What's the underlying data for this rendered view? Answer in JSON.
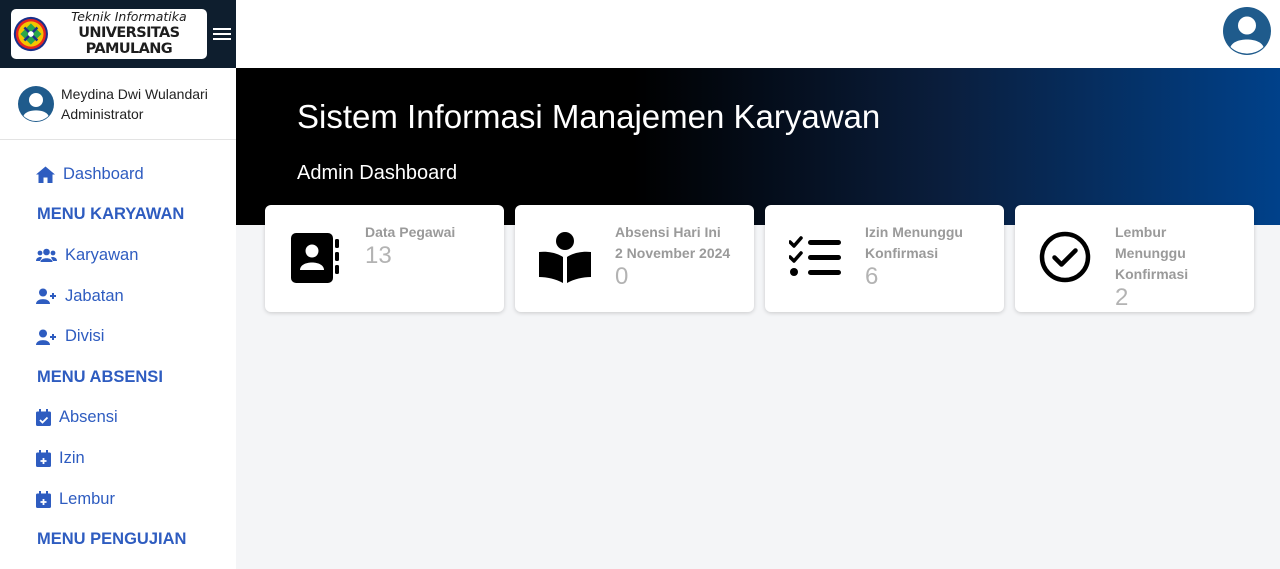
{
  "brand": {
    "subtitle": "Teknik Informatika",
    "name": "UNIVERSITAS PAMULANG"
  },
  "user": {
    "name": "Meydina Dwi Wulandari",
    "role": "Administrator"
  },
  "sidebar": {
    "dashboard": "Dashboard",
    "section_karyawan": "MENU KARYAWAN",
    "karyawan": "Karyawan",
    "jabatan": "Jabatan",
    "divisi": "Divisi",
    "section_absensi": "MENU ABSENSI",
    "absensi": "Absensi",
    "izin": "Izin",
    "lembur": "Lembur",
    "section_pengujian": "MENU PENGUJIAN"
  },
  "hero": {
    "title": "Sistem Informasi Manajemen Karyawan",
    "subtitle": "Admin Dashboard"
  },
  "cards": [
    {
      "label": "Data Pegawai",
      "value": "13",
      "icon": "address-book-icon"
    },
    {
      "label_line1": "Absensi Hari Ini",
      "label_line2": "2 November 2024",
      "value": "0",
      "icon": "reading-person-icon"
    },
    {
      "label_line1": "Izin Menunggu",
      "label_line2": "Konfirmasi",
      "value": "6",
      "icon": "checklist-icon"
    },
    {
      "label_line1": "Lembur",
      "label_line2": "Menunggu",
      "label_line3": "Konfirmasi",
      "value": "2",
      "icon": "check-circle-icon"
    }
  ],
  "colors": {
    "accent": "#2e5cc0",
    "brand_bg": "#0e1e2e",
    "hero_start": "#000000",
    "hero_end": "#00418a"
  }
}
